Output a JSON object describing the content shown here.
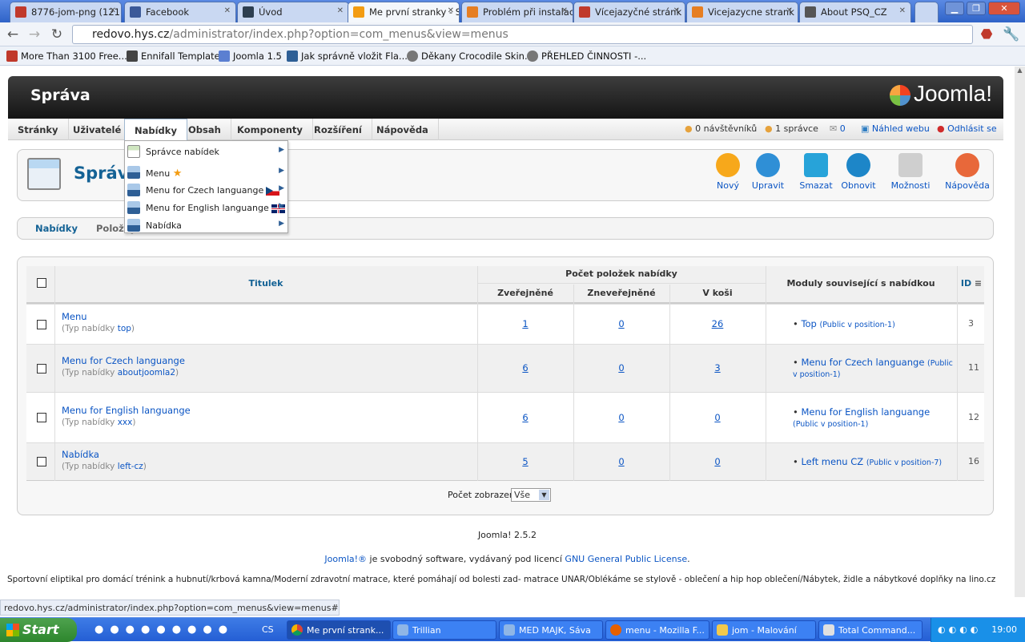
{
  "browser": {
    "tabs": [
      {
        "label": "8776-jom-png (121",
        "color": "#c0392b"
      },
      {
        "label": "Facebook",
        "color": "#3b5998"
      },
      {
        "label": "Úvod",
        "color": "#2c3e50"
      },
      {
        "label": "Me první stranky - S",
        "color": "#f39c12"
      },
      {
        "label": "Problém při instalac",
        "color": "#e67e22"
      },
      {
        "label": "Vícejazyčné stránk",
        "color": "#c0392b"
      },
      {
        "label": "Vicejazycne strank",
        "color": "#e67e22"
      },
      {
        "label": "About PSQ_CZ",
        "color": "#555555"
      }
    ],
    "url_host": "redovo.hys.cz",
    "url_path": "/administrator/index.php?option=com_menus&view=menus",
    "bookmarks": [
      "More Than 3100 Free...",
      "Ennifall Template",
      "Joomla 1.5",
      "Jak správně vložit Fla...",
      "Děkany Crocodile Skin...",
      "PŘEHLED ČINNOSTI -..."
    ],
    "status_url": "redovo.hys.cz/administrator/index.php?option=com_menus&view=menus#"
  },
  "admin": {
    "title": "Správa",
    "logo": "Joomla!",
    "menu": [
      "Stránky",
      "Uživatelé",
      "Nabídky",
      "Obsah",
      "Komponenty",
      "Rozšíření",
      "Nápověda"
    ],
    "status": {
      "visitors": "0 návštěvníků",
      "admins": "1 správce",
      "messages": "0",
      "preview": "Náhled webu",
      "logout": "Odhlásit se"
    },
    "dropdown": [
      "Správce nabídek",
      "Menu",
      "Menu for Czech languange",
      "Menu for English languange",
      "Nabídka"
    ],
    "page_title": "Správce nabídek",
    "toolbar": [
      {
        "label": "Nový",
        "color": "#f7a81b"
      },
      {
        "label": "Upravit",
        "color": "#2f8fd6"
      },
      {
        "label": "Smazat",
        "color": "#27a3d9"
      },
      {
        "label": "Obnovit",
        "color": "#1d86c8"
      },
      {
        "label": "Možnosti",
        "color": "#cfcfcf"
      },
      {
        "label": "Nápověda",
        "color": "#e8683a"
      }
    ],
    "subtabs": [
      "Nabídky",
      "Položky nabídek"
    ]
  },
  "table": {
    "headers": {
      "title": "Titulek",
      "count_group": "Počet položek nabídky",
      "published": "Zveřejněné",
      "unpublished": "Zneveřejněné",
      "trashed": "V koši",
      "modules": "Moduly související s nabídkou",
      "id": "ID"
    },
    "type_label": "(Typ nabídky",
    "rows": [
      {
        "title": "Menu",
        "type": "top",
        "published": "1",
        "unpublished": "0",
        "trashed": "26",
        "module": "Top",
        "module_note": "(Public v position-1)",
        "id": "3"
      },
      {
        "title": "Menu for Czech languange",
        "type": "aboutjoomla2",
        "published": "6",
        "unpublished": "0",
        "trashed": "3",
        "module": "Menu for Czech languange",
        "module_note": "(Public v position-1)",
        "id": "11"
      },
      {
        "title": "Menu for English languange",
        "type": "xxx",
        "published": "6",
        "unpublished": "0",
        "trashed": "0",
        "module": "Menu for English languange",
        "module_note": "(Public v position-1)",
        "id": "12"
      },
      {
        "title": "Nabídka",
        "type": "left-cz",
        "published": "5",
        "unpublished": "0",
        "trashed": "0",
        "module": "Left menu CZ",
        "module_note": "(Public v position-7)",
        "id": "16"
      }
    ],
    "display_label": "Počet zobrazení",
    "display_value": "Vše"
  },
  "footer": {
    "version": "Joomla! 2.5.2",
    "license_link": "Joomla!®",
    "license_text": "je svobodný software, vydávaný pod licencí",
    "gpl": "GNU General Public License",
    "ads": "Sportovní eliptikal pro domácí trénink a hubnutí/krbová kamna/Moderní zdravotní matrace, které pomáhají od bolesti zad- matrace UNAR/Oblékáme se stylově - oblečení a hip hop oblečení/Nábytek, židle a nábytkové doplňky na lino.cz"
  },
  "taskbar": {
    "start": "Start",
    "lang": "CS",
    "tasks": [
      "Me první strank...",
      "Trillian",
      "MED MAJK, Sáva",
      "menu - Mozilla F...",
      "jom - Malování",
      "Total Command..."
    ],
    "clock": "19:00"
  }
}
